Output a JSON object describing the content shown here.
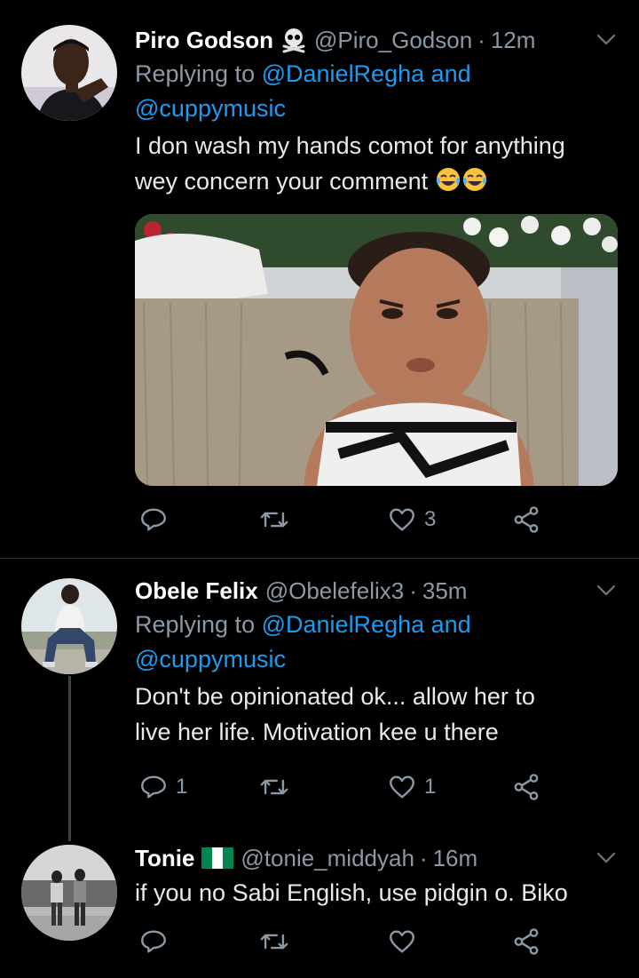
{
  "tweets": [
    {
      "name": "Piro Godson",
      "handle": "@Piro_Godson",
      "time": "12m",
      "reply_prefix": "Replying to",
      "reply_to_1": "@DanielRegha",
      "reply_and": "and",
      "reply_to_2": "@cuppymusic",
      "text_line1": "I don wash my hands comot for anything",
      "text_line2": "wey concern your comment",
      "reply_count": "",
      "like_count": "3"
    },
    {
      "name": "Obele Felix",
      "handle": "@Obelefelix3",
      "time": "35m",
      "reply_prefix": "Replying to",
      "reply_to_1": "@DanielRegha",
      "reply_and": "and",
      "reply_to_2": "@cuppymusic",
      "text_line1": "Don't be opinionated ok... allow her to",
      "text_line2": "live her life. Motivation kee u there",
      "reply_count": "1",
      "like_count": "1"
    },
    {
      "name": "Tonie",
      "handle": "@tonie_middyah",
      "time": "16m",
      "text_line1": "if you no Sabi English, use pidgin o. Biko",
      "reply_count": "",
      "like_count": ""
    }
  ],
  "separator": "·",
  "icons": {
    "badge_piro": "skull-crossbones-icon",
    "emoji": "tears-of-joy-emoji",
    "flag_tonie": "nigeria-flag-icon",
    "reply": "reply-icon",
    "retweet": "retweet-icon",
    "like": "heart-icon",
    "share": "share-icon",
    "more": "chevron-down-icon"
  },
  "colors": {
    "background": "#000000",
    "link": "#1d9bf0",
    "muted": "#8b98a5"
  }
}
